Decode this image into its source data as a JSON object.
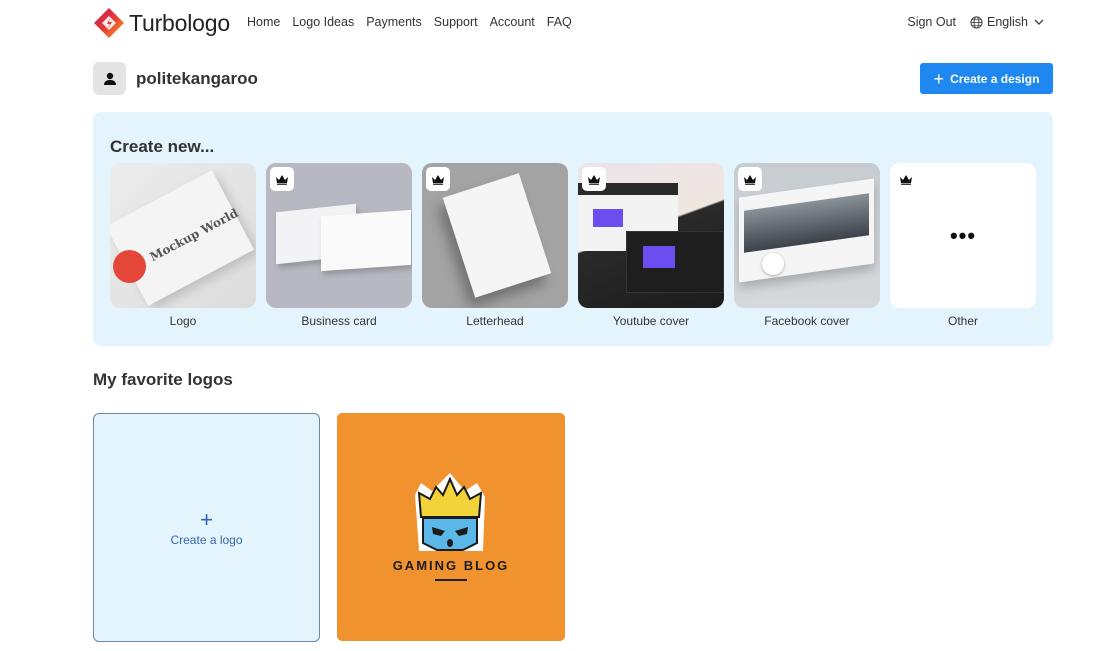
{
  "header": {
    "brand": "Turbologo",
    "nav": [
      "Home",
      "Logo Ideas",
      "Payments",
      "Support",
      "Account",
      "FAQ"
    ],
    "sign_out": "Sign Out",
    "language": "English"
  },
  "user": {
    "username": "politekangaroo",
    "create_design_label": "Create a design"
  },
  "create_new": {
    "title": "Create new...",
    "templates": [
      {
        "label": "Logo",
        "premium": false
      },
      {
        "label": "Business card",
        "premium": true
      },
      {
        "label": "Letterhead",
        "premium": true
      },
      {
        "label": "Youtube cover",
        "premium": true
      },
      {
        "label": "Facebook cover",
        "premium": true
      },
      {
        "label": "Other",
        "premium": true,
        "icon": "more-dots"
      }
    ]
  },
  "favorites": {
    "title": "My favorite logos",
    "create_label": "Create a logo",
    "logos": [
      {
        "name": "GAMING BLOG",
        "background": "#f0922d"
      }
    ]
  },
  "colors": {
    "accent": "#1e88f0",
    "panel": "#e3f4fd"
  }
}
